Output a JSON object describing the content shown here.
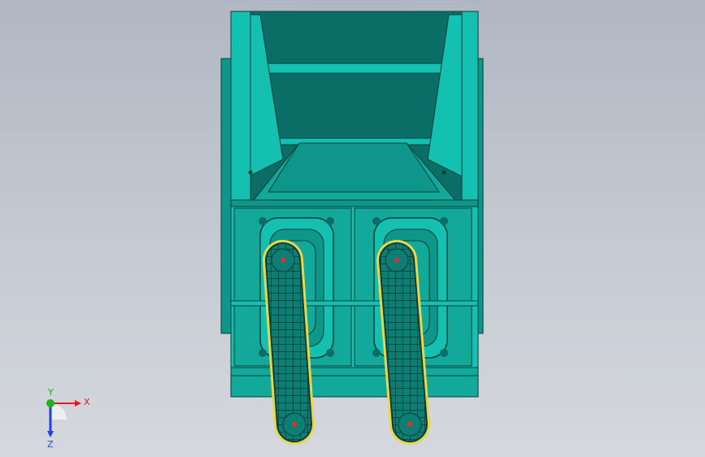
{
  "viewport": {
    "background_top": "#b0b7c3",
    "background_bottom": "#d5d8de"
  },
  "model": {
    "body_color": "#14c0b0",
    "dark_color": "#0a6e66",
    "shadow_color": "#0f968a",
    "belt_color": "#e6d84a",
    "edge_color": "#0b3e3a",
    "accent_color": "#e03030",
    "parts": [
      "hopper",
      "frame",
      "gearbox-left",
      "gearbox-right",
      "track-left",
      "track-right"
    ]
  },
  "triad": {
    "x_label": "X",
    "y_label": "Y",
    "z_label": "Z",
    "x_color": "#e02020",
    "y_color": "#20b020",
    "z_color": "#2040e0"
  }
}
